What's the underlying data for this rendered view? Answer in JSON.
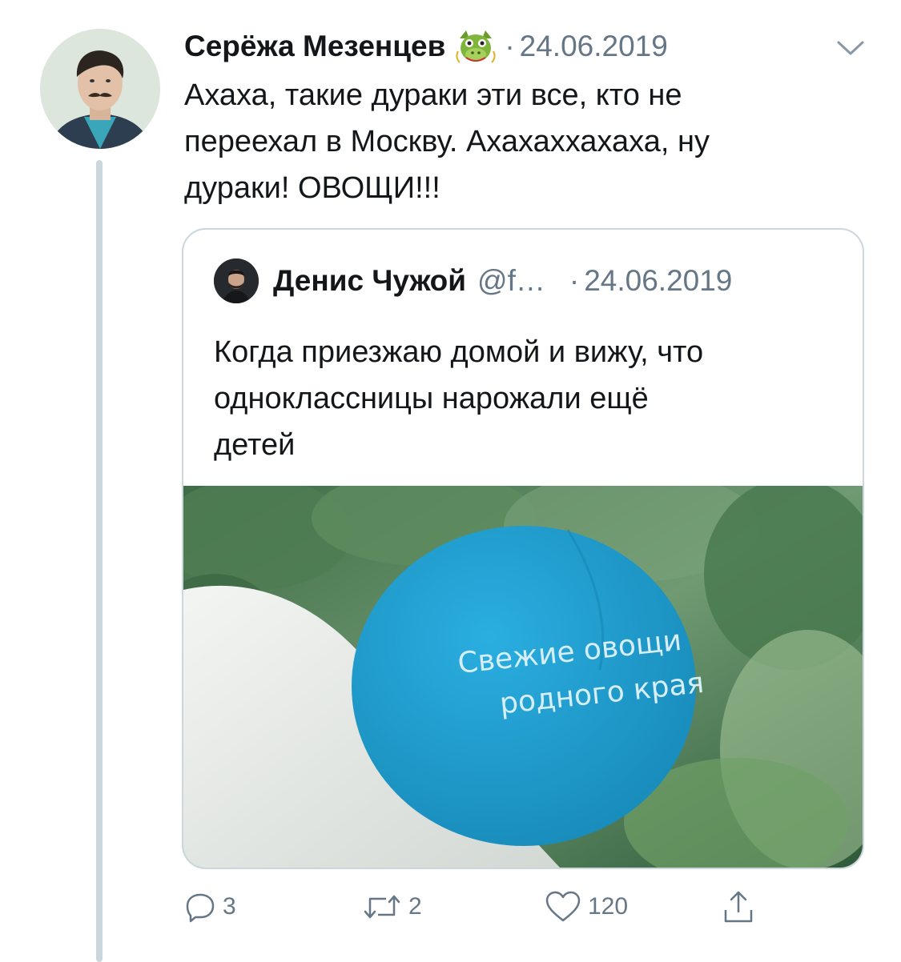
{
  "tweet": {
    "author_name": "Серёжа Мезенцев",
    "badge_icon": "dragon-face-icon",
    "separator": "·",
    "date": "24.06.2019",
    "text_lines": [
      "Ахаха, такие дураки эти все, кто не",
      "переехал в Москву. Ахахаххахаха, ну",
      "дураки! ОВОЩИ!!!"
    ]
  },
  "quote": {
    "author_name": "Денис Чужой",
    "handle": "@f…",
    "separator": "·",
    "date": "24.06.2019",
    "text_lines": [
      "Когда приезжаю домой и вижу, что",
      "одноклассницы нарожали ещё",
      "детей"
    ],
    "image": {
      "sticker_line1": "Свежие овощи",
      "sticker_line2": "родного края",
      "sticker_color": "#1ea1d6"
    }
  },
  "actions": {
    "reply_count": "3",
    "retweet_count": "2",
    "like_count": "120"
  },
  "colors": {
    "text": "#14171a",
    "muted": "#657786",
    "border": "#ccd6dd"
  }
}
